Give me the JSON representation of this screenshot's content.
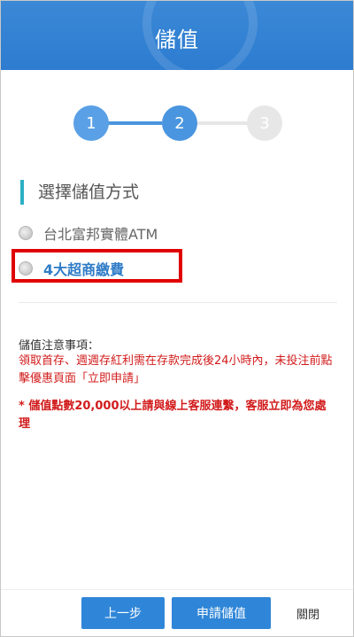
{
  "header": {
    "title": "儲值"
  },
  "stepper": {
    "steps": [
      "1",
      "2",
      "3"
    ],
    "current_step": 2
  },
  "section": {
    "title": "選擇儲值方式"
  },
  "options": [
    {
      "label": "台北富邦實體ATM",
      "selected": false
    },
    {
      "label": "4大超商繳費",
      "selected": false,
      "highlighted": true
    }
  ],
  "notes": {
    "title": "儲值注意事項：",
    "line1": "領取首存、週週存紅利需在存款完成後24小時內，未投注前點擊優惠頁面「立即申請」",
    "warning": "* 儲值點數20,000以上請與線上客服連繫，客服立即為您處理"
  },
  "footer": {
    "prev_label": "上一步",
    "apply_label": "申請儲值",
    "close_label": "關閉"
  },
  "colors": {
    "header_blue": "#2d7cd0",
    "step_active": "#4a95df",
    "accent_teal": "#2bb0c5",
    "warning_red": "#d21b1b",
    "highlight_red": "#e00000",
    "button_blue": "#2f86d8"
  }
}
